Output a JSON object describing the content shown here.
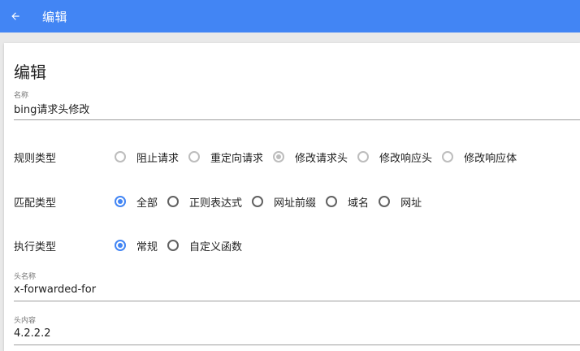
{
  "appbar": {
    "title": "编辑",
    "back_icon": "arrow-left-icon"
  },
  "card": {
    "title": "编辑"
  },
  "fields": {
    "name": {
      "label": "名称",
      "value": "bing请求头修改"
    },
    "header_name": {
      "label": "头名称",
      "value": "x-forwarded-for"
    },
    "header_value": {
      "label": "头内容",
      "value": "4.2.2.2"
    }
  },
  "rule_type": {
    "label": "规则类型",
    "options": [
      "阻止请求",
      "重定向请求",
      "修改请求头",
      "修改响应头",
      "修改响应体"
    ],
    "selected": "修改请求头",
    "disabled": true
  },
  "match_type": {
    "label": "匹配类型",
    "options": [
      "全部",
      "正则表达式",
      "网址前缀",
      "域名",
      "网址"
    ],
    "selected": "全部"
  },
  "exec_type": {
    "label": "执行类型",
    "options": [
      "常规",
      "自定义函数"
    ],
    "selected": "常规"
  },
  "colors": {
    "primary": "#4285f4",
    "disabled_radio": "#bdbdbd"
  }
}
